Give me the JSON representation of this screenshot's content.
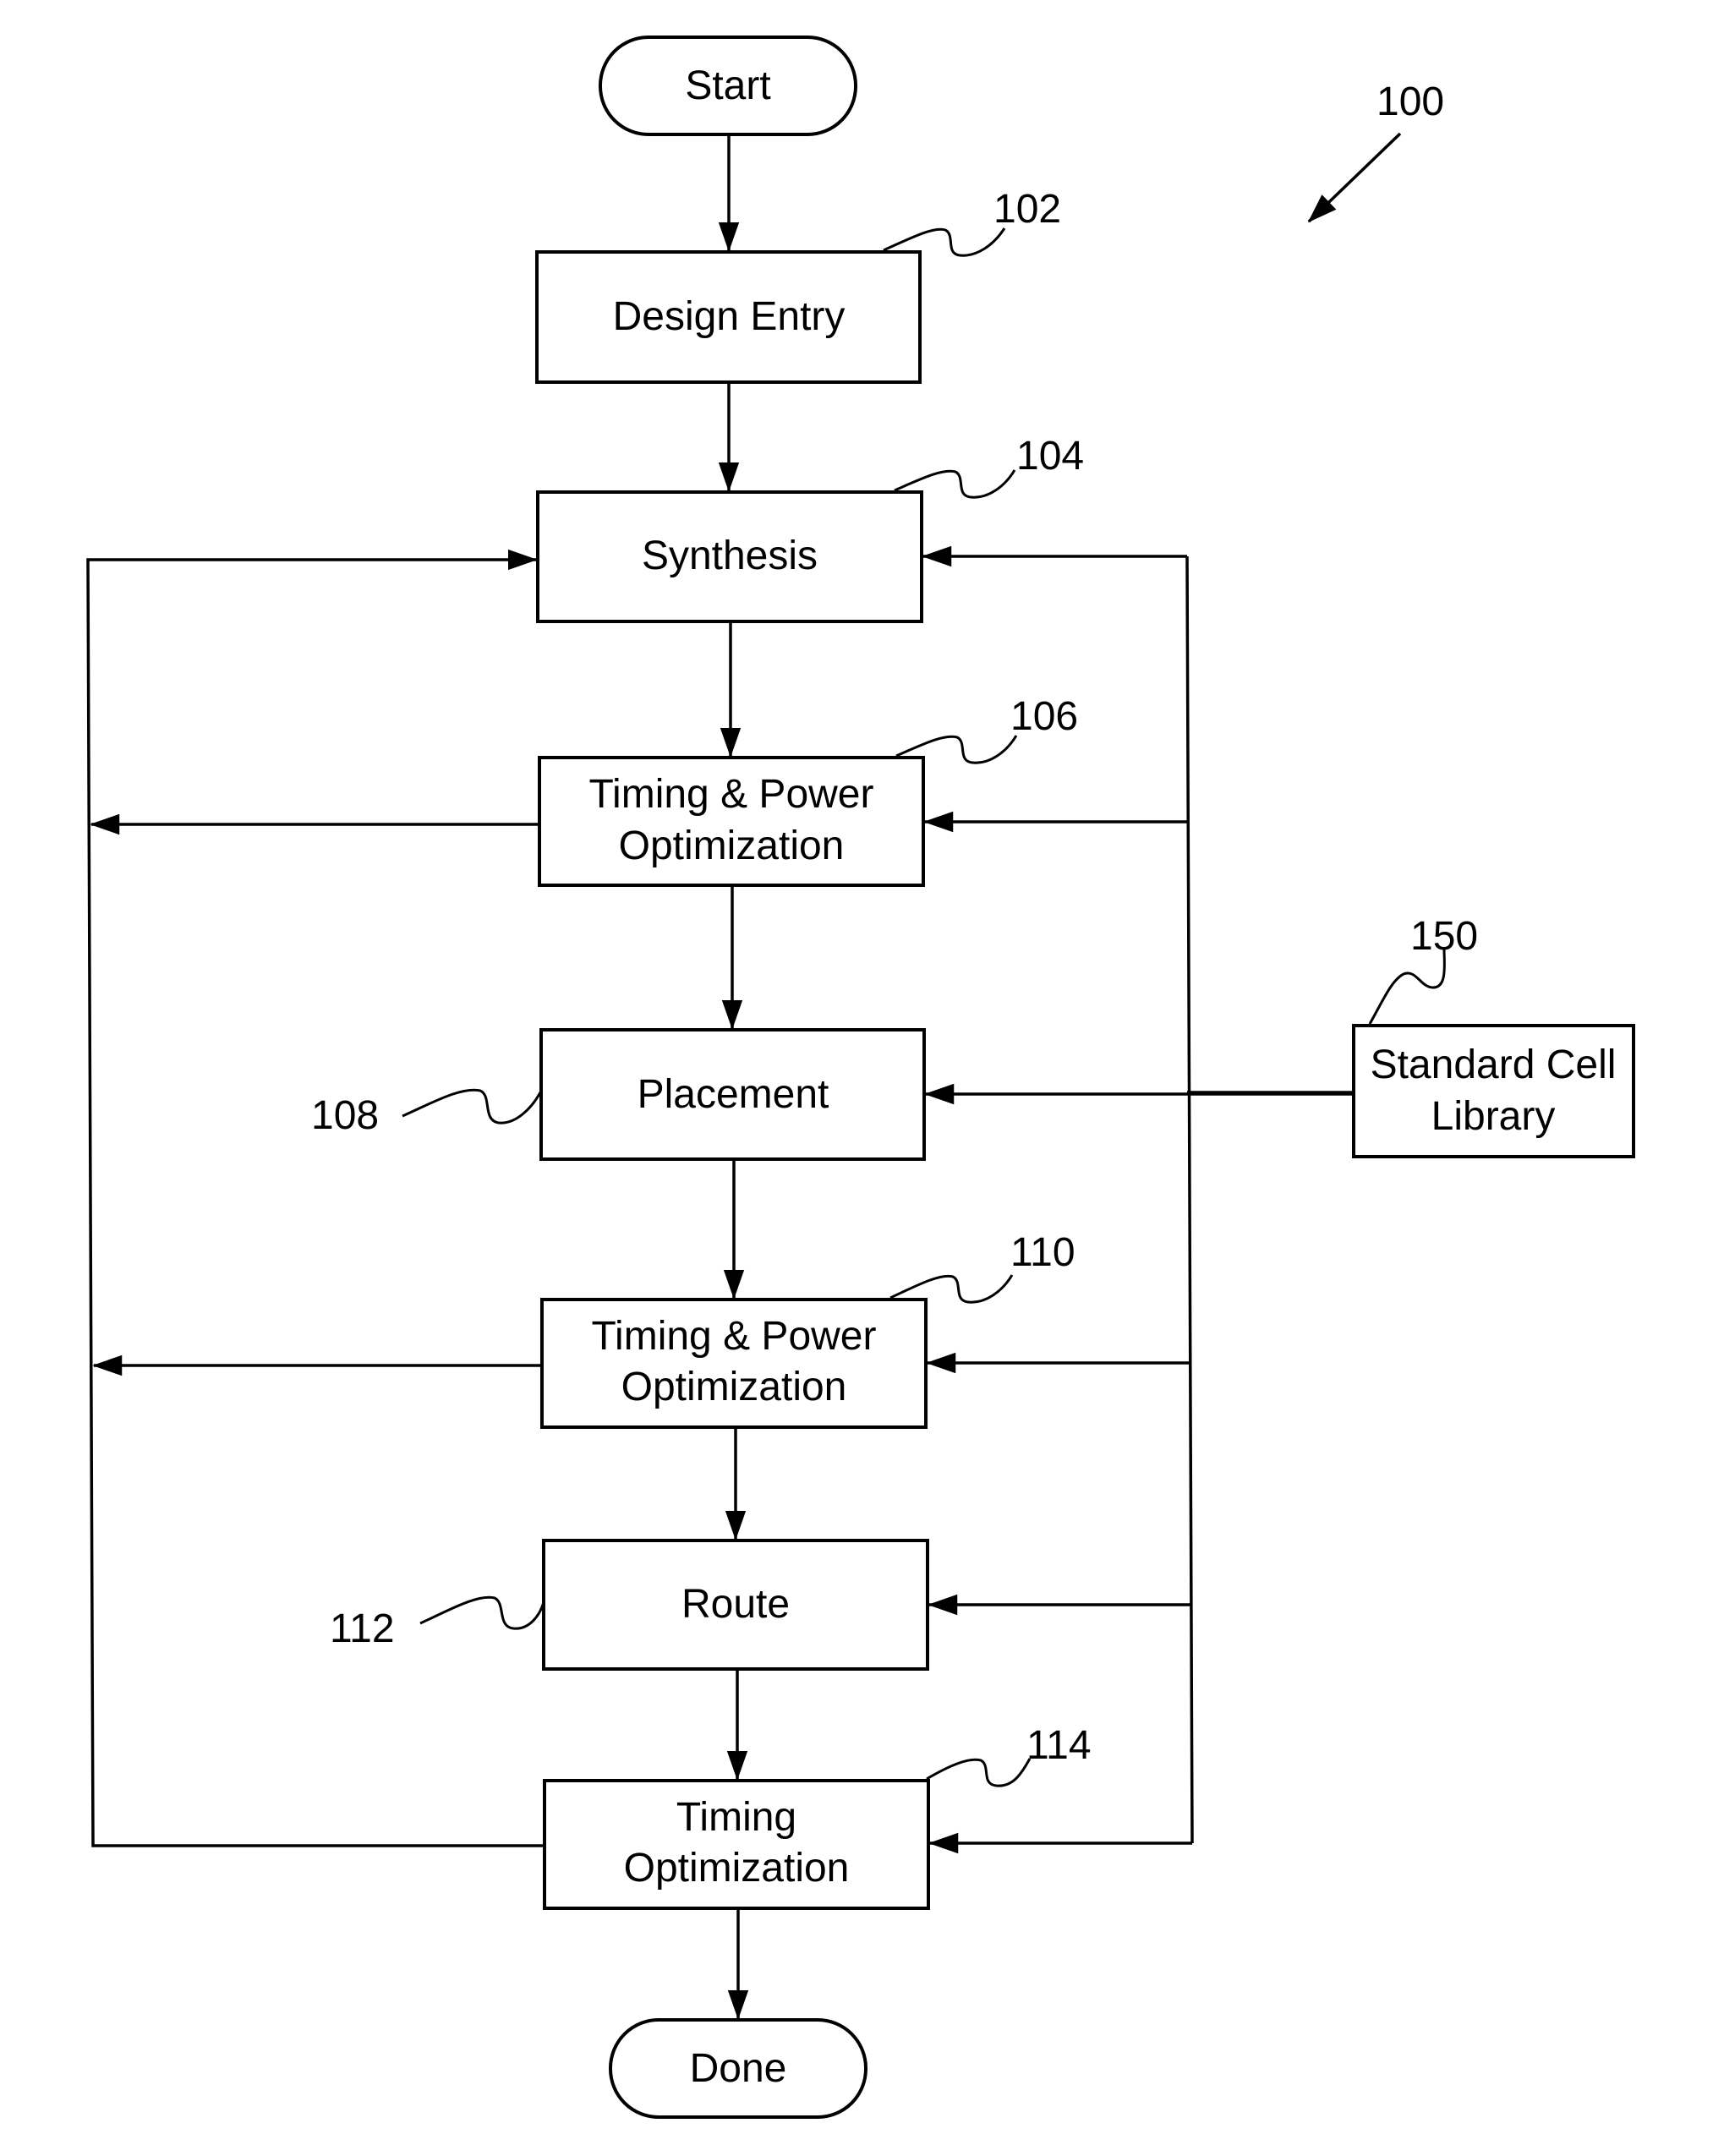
{
  "figure": {
    "reference": "100",
    "terminals": {
      "start": "Start",
      "done": "Done"
    },
    "steps": [
      {
        "id": "design-entry",
        "ref": "102",
        "lines": [
          "Design Entry"
        ]
      },
      {
        "id": "synthesis",
        "ref": "104",
        "lines": [
          "Synthesis"
        ]
      },
      {
        "id": "timing-power-opt-1",
        "ref": "106",
        "lines": [
          "Timing & Power",
          "Optimization"
        ]
      },
      {
        "id": "placement",
        "ref": "108",
        "lines": [
          "Placement"
        ]
      },
      {
        "id": "timing-power-opt-2",
        "ref": "110",
        "lines": [
          "Timing & Power",
          "Optimization"
        ]
      },
      {
        "id": "route",
        "ref": "112",
        "lines": [
          "Route"
        ]
      },
      {
        "id": "timing-opt",
        "ref": "114",
        "lines": [
          "Timing",
          "Optimization"
        ]
      }
    ],
    "library": {
      "ref": "150",
      "lines": [
        "Standard Cell",
        "Library"
      ]
    }
  }
}
